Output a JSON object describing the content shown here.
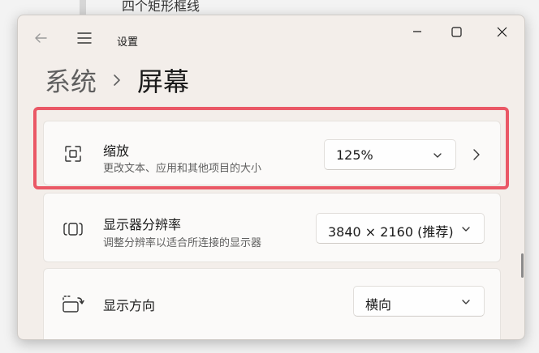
{
  "background": {
    "partial_text": "四个矩形框线"
  },
  "titlebar": {
    "app_title": "设置",
    "back_icon": "arrow-left-icon",
    "menu_icon": "hamburger-menu-icon",
    "minimize_icon": "minimize-icon",
    "maximize_icon": "maximize-icon",
    "close_icon": "close-icon"
  },
  "breadcrumb": {
    "parent": "系统",
    "separator_icon": "chevron-right-icon",
    "current": "屏幕"
  },
  "settings": [
    {
      "id": "scale",
      "icon": "scale-icon",
      "title": "缩放",
      "subtitle": "更改文本、应用和其他项目的大小",
      "value": "125%",
      "has_chevron": true
    },
    {
      "id": "resolution",
      "icon": "resolution-icon",
      "title": "显示器分辨率",
      "subtitle": "调整分辨率以适合所连接的显示器",
      "value": "3840 × 2160 (推荐)"
    },
    {
      "id": "orientation",
      "icon": "orientation-icon",
      "title": "显示方向",
      "value": "横向"
    }
  ],
  "colors": {
    "highlight": "#ea5866",
    "window_bg": "#f3eeea",
    "card_bg": "#fbfaf9"
  }
}
